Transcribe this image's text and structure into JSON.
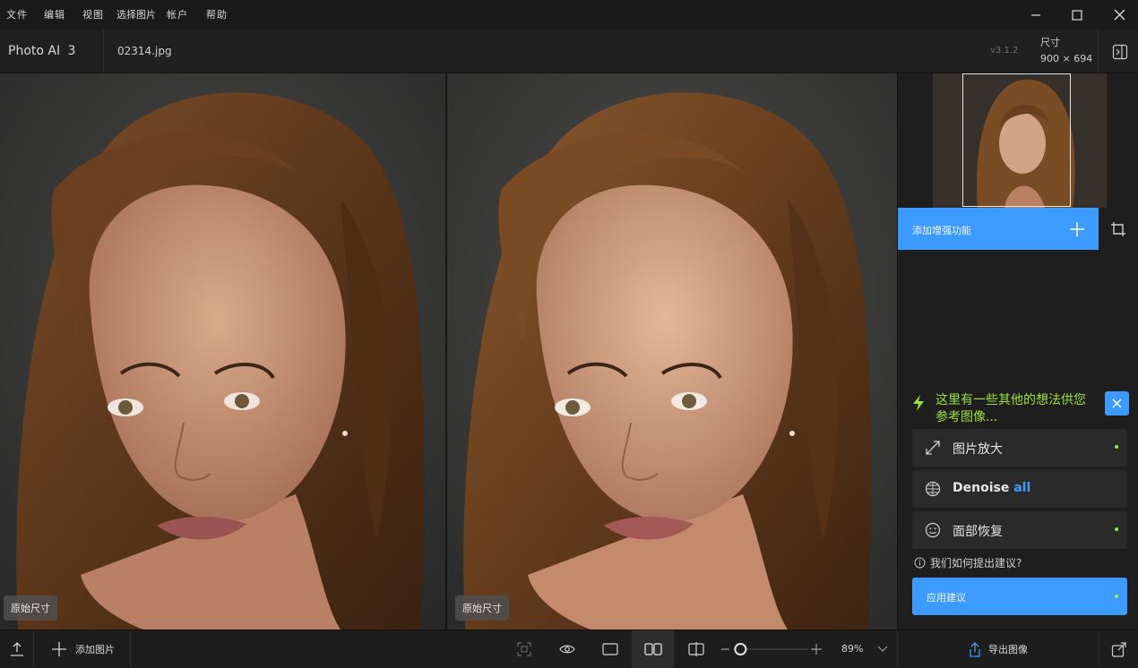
{
  "menu": {
    "file": "文件",
    "edit": "编辑",
    "view": "视图",
    "select_image": "选择图片",
    "account": "帐户",
    "help": "帮助"
  },
  "header": {
    "app_name": "Photo AI",
    "app_version_major": "3",
    "filename": "02314.jpg",
    "version": "v3.1.2",
    "size_label": "尺寸",
    "size_value": "900 × 694"
  },
  "panes": {
    "left_badge": "原始尺寸",
    "right_badge": "原始尺寸"
  },
  "sidebar": {
    "add_enhancement": "添加增强功能",
    "suggestion_title_line1": "这里有一些其他的想法供您",
    "suggestion_title_line2": "参考图像...",
    "items": [
      {
        "label": "图片放大",
        "icon": "expand-arrows-icon"
      },
      {
        "label": "Denoise",
        "suffix": "all",
        "icon": "globe-grid-icon"
      },
      {
        "label": "面部恢复",
        "icon": "smiley-face-icon"
      }
    ],
    "how_suggest": "我们如何提出建议?",
    "apply": "应用建议"
  },
  "bottom": {
    "add_image": "添加图片",
    "zoom": "89%",
    "zoom_fraction": 0.1,
    "export": "导出图像"
  },
  "colors": {
    "accent_blue": "#3d9bff",
    "accent_green": "#9be23b",
    "panel_dark": "#1e1e1e"
  }
}
